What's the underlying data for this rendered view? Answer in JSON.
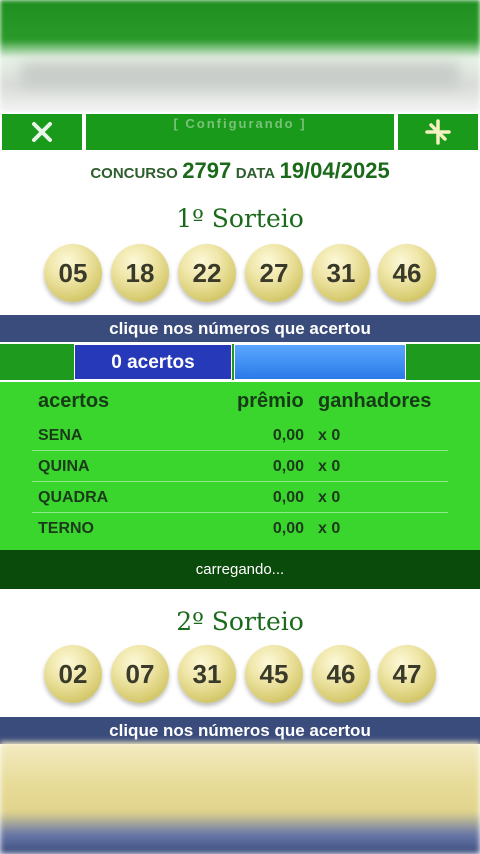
{
  "toolbar": {
    "status_text": "[ Configurando ]",
    "left_icon": "close-x-icon",
    "right_icon": "plus-star-icon"
  },
  "header": {
    "concurso_label": "CONCURSO",
    "concurso_value": "2797",
    "data_label": "DATA",
    "data_value": "19/04/2025"
  },
  "draw1": {
    "title": "1º Sorteio",
    "numbers": [
      "05",
      "18",
      "22",
      "27",
      "31",
      "46"
    ],
    "instruction": "clique nos números que acertou"
  },
  "hits": {
    "label": "0 acertos"
  },
  "prizes": {
    "headers": {
      "acertos": "acertos",
      "premio": "prêmio",
      "ganhadores": "ganhadores"
    },
    "rows": [
      {
        "name": "SENA",
        "prize": "0,00",
        "winners": "x 0"
      },
      {
        "name": "QUINA",
        "prize": "0,00",
        "winners": "x 0"
      },
      {
        "name": "QUADRA",
        "prize": "0,00",
        "winners": "x 0"
      },
      {
        "name": "TERNO",
        "prize": "0,00",
        "winners": "x 0"
      }
    ]
  },
  "loading_text": "carregando...",
  "draw2": {
    "title": "2º Sorteio",
    "numbers": [
      "02",
      "07",
      "31",
      "45",
      "46",
      "47"
    ],
    "instruction": "clique nos números que acertou"
  },
  "colors": {
    "green": "#1a9a1a",
    "bright_green": "#3ad62e",
    "dark_green": "#0a4a0a",
    "navy": "#3a4c7c",
    "blue": "#2639b8",
    "ball": "#efe6a8"
  }
}
